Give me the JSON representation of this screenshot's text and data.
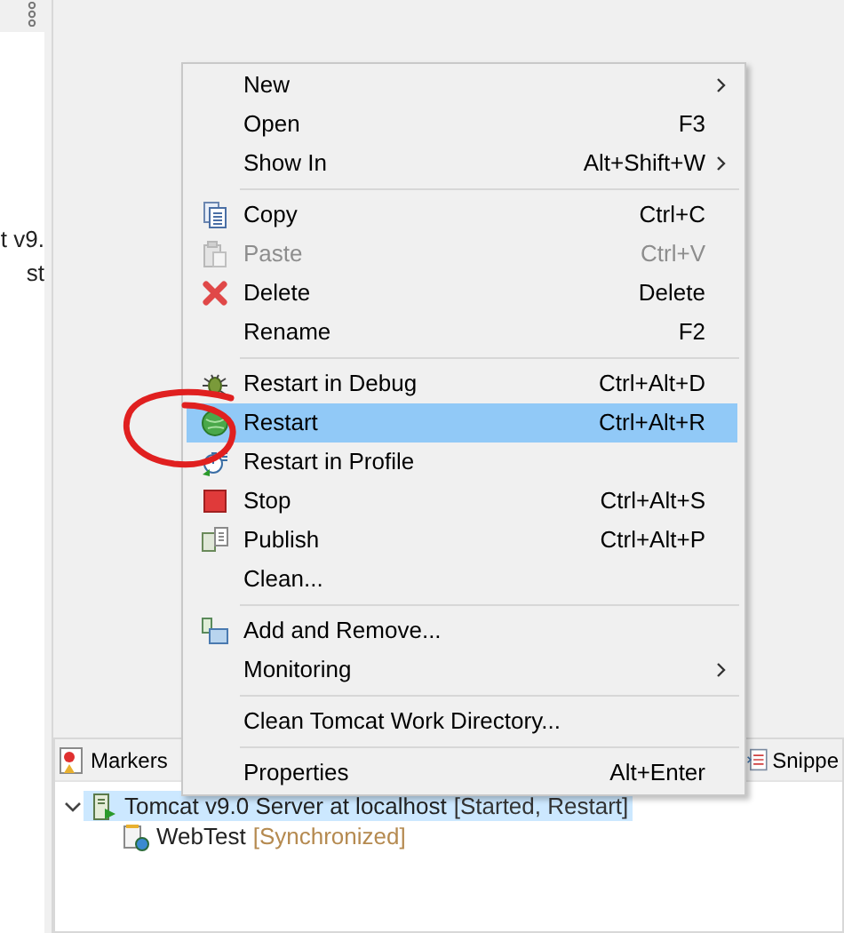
{
  "left_panel": {
    "lines": [
      "t v9.",
      "st"
    ]
  },
  "bottom_panel": {
    "tabs": [
      {
        "label": "Markers",
        "kind": "markers",
        "selected": false
      },
      {
        "label": "Snippe",
        "kind": "snippets",
        "selected": false
      }
    ],
    "tree": [
      {
        "label": "Tomcat v9.0 Server at localhost",
        "status": "[Started, Restart]",
        "selected": true,
        "expanded": true,
        "children": [
          {
            "label": "WebTest",
            "status": "[Synchronized]",
            "selected": false
          }
        ]
      }
    ]
  },
  "context_menu": {
    "items": [
      {
        "kind": "item",
        "label": "New",
        "submenu": true
      },
      {
        "kind": "item",
        "label": "Open",
        "shortcut": "F3"
      },
      {
        "kind": "item",
        "label": "Show In",
        "shortcut": "Alt+Shift+W",
        "submenu": true
      },
      {
        "kind": "separator"
      },
      {
        "kind": "copy",
        "label": "Copy",
        "shortcut": "Ctrl+C"
      },
      {
        "kind": "paste",
        "label": "Paste",
        "shortcut": "Ctrl+V",
        "disabled": true
      },
      {
        "kind": "delete",
        "label": "Delete",
        "shortcut": "Delete"
      },
      {
        "kind": "item",
        "label": "Rename",
        "shortcut": "F2"
      },
      {
        "kind": "separator"
      },
      {
        "kind": "debug",
        "label": "Restart in Debug",
        "shortcut": "Ctrl+Alt+D"
      },
      {
        "kind": "restart",
        "label": "Restart",
        "shortcut": "Ctrl+Alt+R",
        "selected": true
      },
      {
        "kind": "profile",
        "label": "Restart in Profile"
      },
      {
        "kind": "stop",
        "label": "Stop",
        "shortcut": "Ctrl+Alt+S"
      },
      {
        "kind": "publish",
        "label": "Publish",
        "shortcut": "Ctrl+Alt+P"
      },
      {
        "kind": "item",
        "label": "Clean..."
      },
      {
        "kind": "separator"
      },
      {
        "kind": "addremove",
        "label": "Add and Remove..."
      },
      {
        "kind": "item",
        "label": "Monitoring",
        "submenu": true
      },
      {
        "kind": "separator"
      },
      {
        "kind": "item",
        "label": "Clean Tomcat Work Directory..."
      },
      {
        "kind": "separator"
      },
      {
        "kind": "item",
        "label": "Properties",
        "shortcut": "Alt+Enter"
      }
    ]
  }
}
